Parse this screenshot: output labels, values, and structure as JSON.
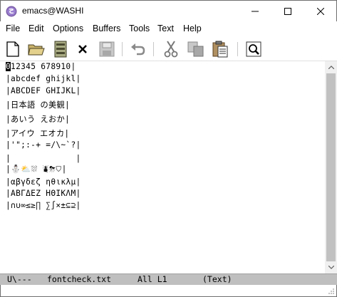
{
  "window": {
    "title": "emacs@WASHI"
  },
  "menubar": {
    "items": [
      "File",
      "Edit",
      "Options",
      "Buffers",
      "Tools",
      "Text",
      "Help"
    ]
  },
  "toolbar": {
    "icons": [
      "new-file-icon",
      "open-folder-icon",
      "dired-icon",
      "close-icon",
      "save-icon",
      "undo-icon",
      "cut-icon",
      "copy-icon",
      "paste-icon",
      "search-icon"
    ]
  },
  "buffer": {
    "cursor_char": "|",
    "lines": [
      "012345 678910|",
      "|abcdef ghijkl|",
      "|ABCDEF GHIJKL|",
      "|日本語 の美観|",
      "|あいう えおか|",
      "|アイウ エオカ|",
      "|'\";:-+ =/\\~`?|",
      "|             |",
      "|⛄⛅⛆ ⛇⛈⛉|",
      "|αβγδεζ ηθικλμ|",
      "|ΑΒΓΔΕΖ ΗΘΙΚΛΜ|",
      "|∩∪∞≤≥∏ ∑∫×±⊆⊇|"
    ]
  },
  "modeline": {
    "status": "U\\---",
    "filename": "fontcheck.txt",
    "position": "All L1",
    "mode": "(Text)"
  },
  "colors": {
    "modeline_bg": "#bfbfbf",
    "scroll_thumb": "#c1c1c1"
  }
}
